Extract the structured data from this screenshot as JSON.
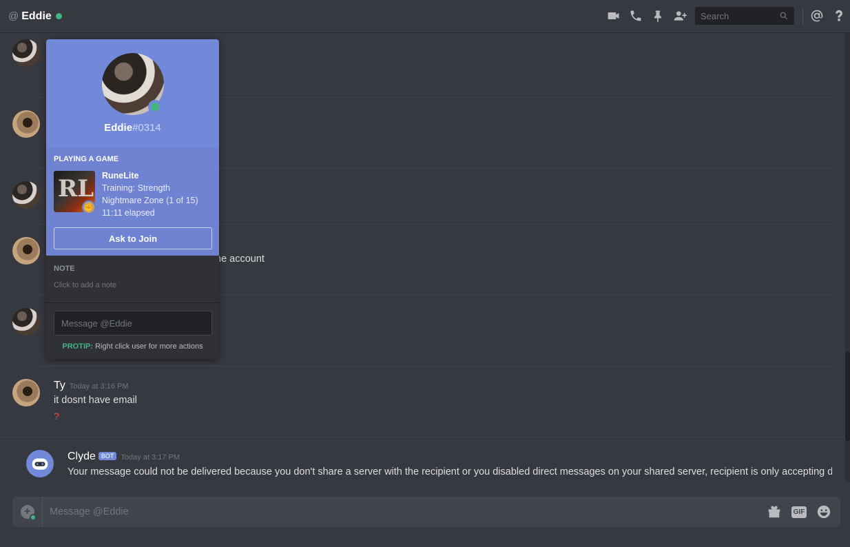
{
  "header": {
    "at_symbol": "@",
    "title": "Eddie",
    "search_placeholder": "Search",
    "status_color": "#43b581"
  },
  "messages": [
    {
      "author": "Ty",
      "time": "Today at 3:16 PM",
      "text": "it dosnt have email",
      "reaction": "?"
    },
    {
      "partial_text": "ne account"
    }
  ],
  "clyde": {
    "author": "Clyde",
    "tag": "BOT",
    "time": "Today at 3:17 PM",
    "text": "Your message could not be delivered because you don't share a server with the recipient or you disabled direct messages on your shared server, recipient is only accepting direct"
  },
  "composer": {
    "placeholder": "Message @Eddie",
    "gif_label": "GIF"
  },
  "popout": {
    "username": "Eddie",
    "discriminator": "#0314",
    "activity_header": "PLAYING A GAME",
    "game_title": "RuneLite",
    "details": "Training: Strength",
    "state": "Nightmare Zone (1 of 15)",
    "elapsed": "11:11 elapsed",
    "game_logo": "RL",
    "join_label": "Ask to Join",
    "note_header": "NOTE",
    "note_placeholder": "Click to add a note",
    "message_placeholder": "Message @Eddie",
    "protip_label": "PROTIP:",
    "protip_text": "Right click user for more actions",
    "accent_color": "#7289da"
  }
}
